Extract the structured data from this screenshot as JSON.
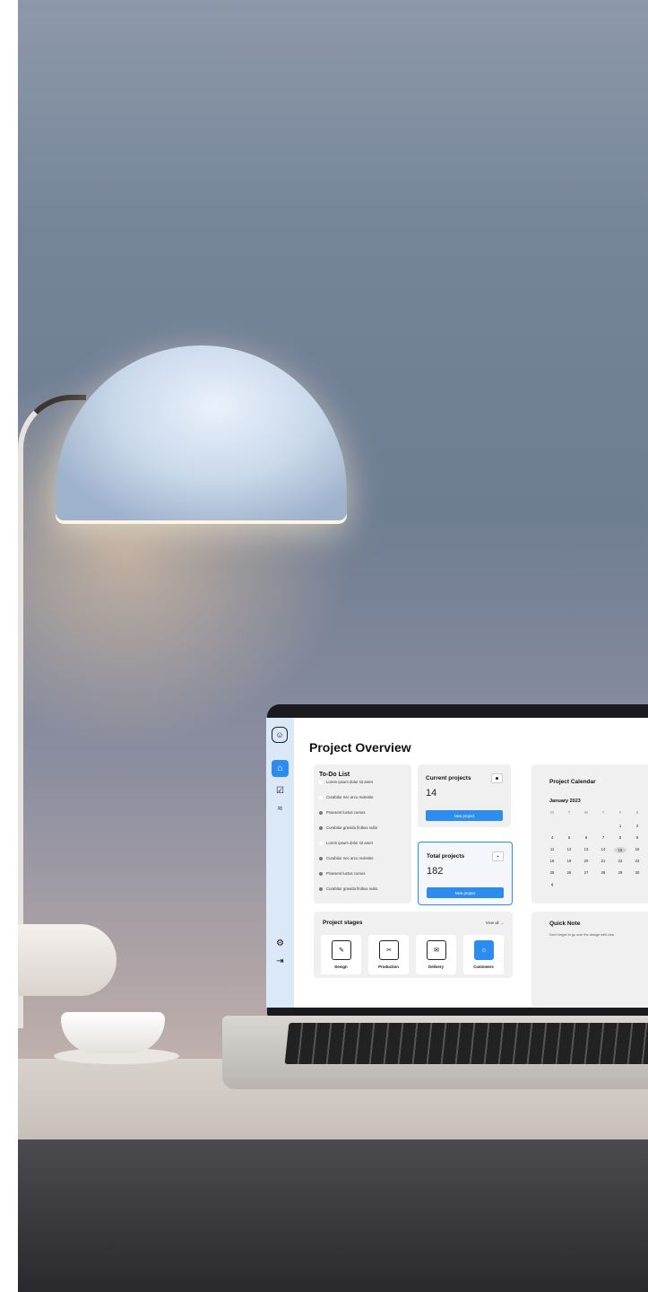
{
  "app": {
    "page_title": "Project Overview"
  },
  "sidebar": {
    "icons": [
      "support-icon",
      "home-icon",
      "check-icon",
      "analytics-icon",
      "gear-icon",
      "logout-icon"
    ]
  },
  "todo": {
    "title": "To-Do List",
    "items": [
      {
        "label": "Lorem ipsum dolor sit amet",
        "done": false
      },
      {
        "label": "Curabitur nec arcu molestie",
        "done": false
      },
      {
        "label": "Praesent luctus cursus",
        "done": true
      },
      {
        "label": "Curabitur gravida finibus nulla",
        "done": true
      },
      {
        "label": "Lorem ipsum dolor sit amet",
        "done": false
      },
      {
        "label": "Curabitur nec arcu molestie",
        "done": true
      },
      {
        "label": "Praesent luctus cursus",
        "done": true
      },
      {
        "label": "Curabitur gravida finibus nulla",
        "done": true
      }
    ]
  },
  "current_projects": {
    "label": "Current projects",
    "value": "14",
    "button": "New project"
  },
  "total_projects": {
    "label": "Total projects",
    "value": "182",
    "button": "New project"
  },
  "stages": {
    "title": "Project stages",
    "view_all": "View all →",
    "items": [
      {
        "label": "Design",
        "icon": "brush-icon"
      },
      {
        "label": "Production",
        "icon": "scissors-icon"
      },
      {
        "label": "Delivery",
        "icon": "mail-icon"
      },
      {
        "label": "Customers",
        "icon": "smile-icon",
        "active": true
      }
    ]
  },
  "calendar": {
    "title": "Project Calendar",
    "month": "January 2023",
    "weekdays": [
      "M",
      "T",
      "W",
      "T",
      "F",
      "S"
    ],
    "weeks": [
      [
        "",
        "",
        "",
        "",
        "1",
        "2"
      ],
      [
        "4",
        "5",
        "6",
        "7",
        "8",
        "9"
      ],
      [
        "11",
        "12",
        "13",
        "14",
        "15",
        "16"
      ],
      [
        "18",
        "19",
        "20",
        "21",
        "22",
        "23"
      ],
      [
        "25",
        "26",
        "27",
        "28",
        "29",
        "30"
      ]
    ],
    "today": "15",
    "prev": "‹"
  },
  "quick_note": {
    "title": "Quick Note",
    "text": "Don't forget to go over the design with Lisa"
  },
  "colors": {
    "accent": "#2d8cf0",
    "sidebar": "#dbe8f8",
    "card": "#f0f0f0"
  }
}
